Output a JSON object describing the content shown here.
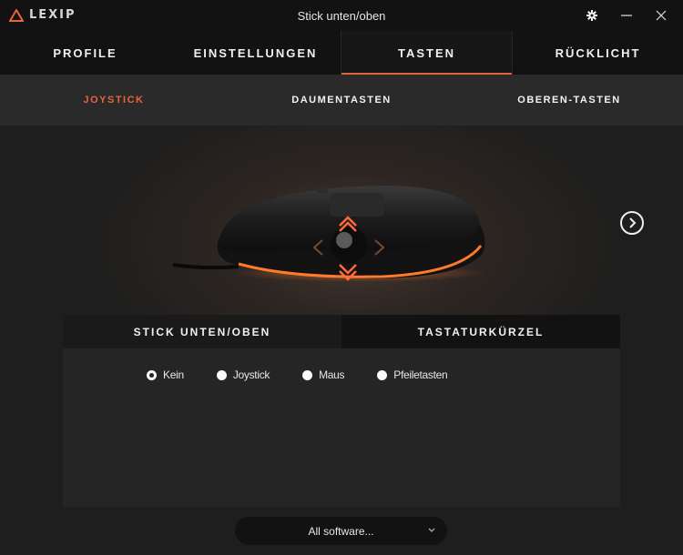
{
  "window": {
    "logo_text": "LEXIP",
    "title": "Stick unten/oben",
    "controls": [
      "gear-icon",
      "minimize-icon",
      "close-icon"
    ]
  },
  "main_tabs": [
    {
      "label": "PROFILE",
      "active": false
    },
    {
      "label": "EINSTELLUNGEN",
      "active": false
    },
    {
      "label": "TASTEN",
      "active": true
    },
    {
      "label": "RÜCKLICHT",
      "active": false
    }
  ],
  "sub_tabs": [
    {
      "label": "JOYSTICK",
      "active": true
    },
    {
      "label": "DAUMENTASTEN",
      "active": false
    },
    {
      "label": "OBEREN-TASTEN",
      "active": false
    }
  ],
  "panel": {
    "tabs": [
      {
        "label": "STICK UNTEN/OBEN",
        "active": true
      },
      {
        "label": "TASTATURKÜRZEL",
        "active": false
      }
    ],
    "options": [
      {
        "label": "Kein",
        "checked": true
      },
      {
        "label": "Joystick",
        "checked": false
      },
      {
        "label": "Maus",
        "checked": false
      },
      {
        "label": "Pfeiletasten",
        "checked": false
      }
    ]
  },
  "software_select": {
    "value": "All software..."
  },
  "colors": {
    "accent": "#e8643c",
    "background": "#1e1e1e",
    "bar": "#121212"
  }
}
